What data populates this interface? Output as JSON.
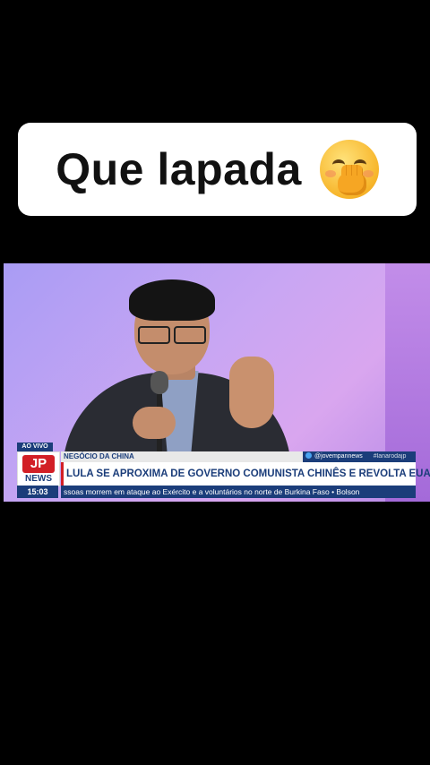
{
  "caption": {
    "text": "Que lapada",
    "emoji": "face-with-hand-over-mouth-emoji"
  },
  "broadcast": {
    "live_label": "AO VIVO",
    "logo_top": "JP",
    "logo_bottom": "NEWS",
    "topic": "NEGÓCIO DA CHINA",
    "handle": "@jovempannews",
    "hashtag": "#lanarodajp",
    "headline": "LULA SE APROXIMA DE GOVERNO COMUNISTA CHINÊS E REVOLTA EUA",
    "time": "15:03",
    "crawl": "ssoas morrem em ataque ao Exército e a voluntários no norte de Burkina Faso • Bolson"
  },
  "colors": {
    "brand_red": "#d21f26",
    "brand_blue": "#1b3d7a",
    "background": "#000000"
  }
}
